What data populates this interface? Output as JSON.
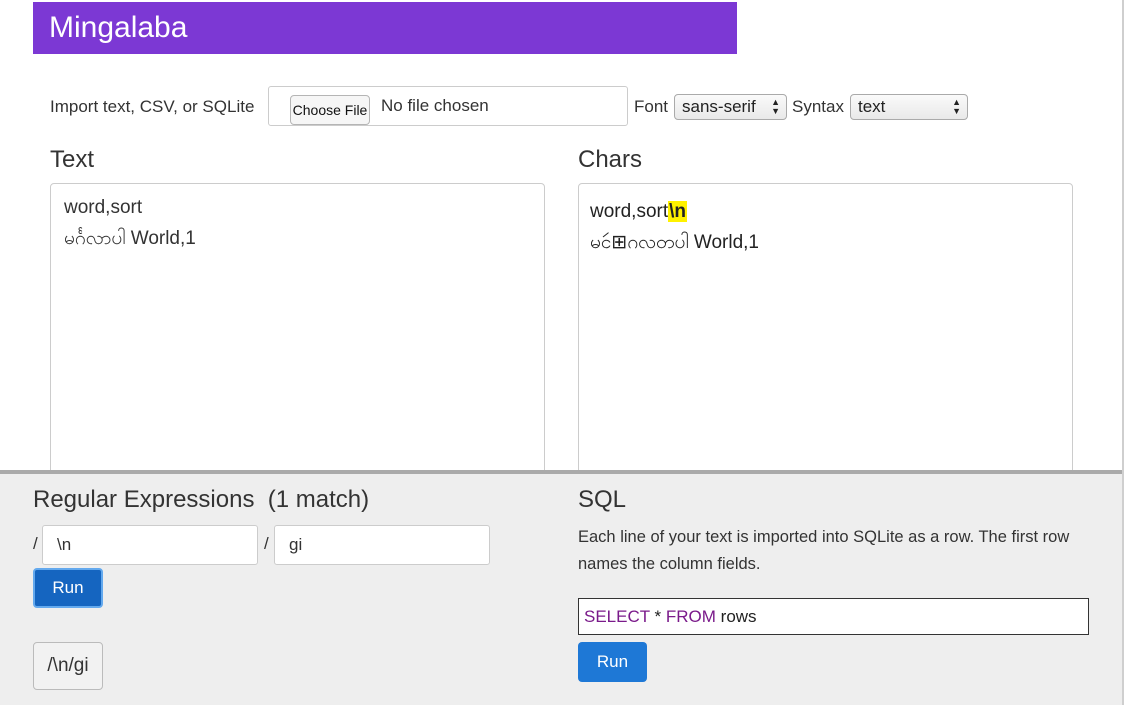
{
  "app": {
    "title": "Mingalaba"
  },
  "import": {
    "label": "Import text, CSV, or SQLite",
    "choose_file_label": "Choose File",
    "file_status": "No file chosen",
    "font_label": "Font",
    "font_value": "sans-serif",
    "syntax_label": "Syntax",
    "syntax_value": "text"
  },
  "text_pane": {
    "title": "Text",
    "lines": [
      "word,sort",
      "မင်္ဂလာပါ World,1"
    ]
  },
  "chars_pane": {
    "title": "Chars",
    "line1_text": "word,sort",
    "line1_match": "\\n",
    "line2_text": "မငဴ⊞ဂလတပါ World,1"
  },
  "regex": {
    "title": "Regular Expressions  (1 match)",
    "slash": "/",
    "pattern": "\\n",
    "flags": "gi",
    "run_label": "Run",
    "history_item": "/\\n/gi"
  },
  "sql": {
    "title": "SQL",
    "description": "Each line of your text is imported into SQLite as a row. The first row names the column fields.",
    "query_kw_select": "SELECT",
    "query_star": " * ",
    "query_kw_from": "FROM",
    "query_rest": " rows",
    "run_label": "Run"
  },
  "colors": {
    "banner": "#7c38d4",
    "run_button": "#1e78d6",
    "highlight": "#fff200"
  }
}
